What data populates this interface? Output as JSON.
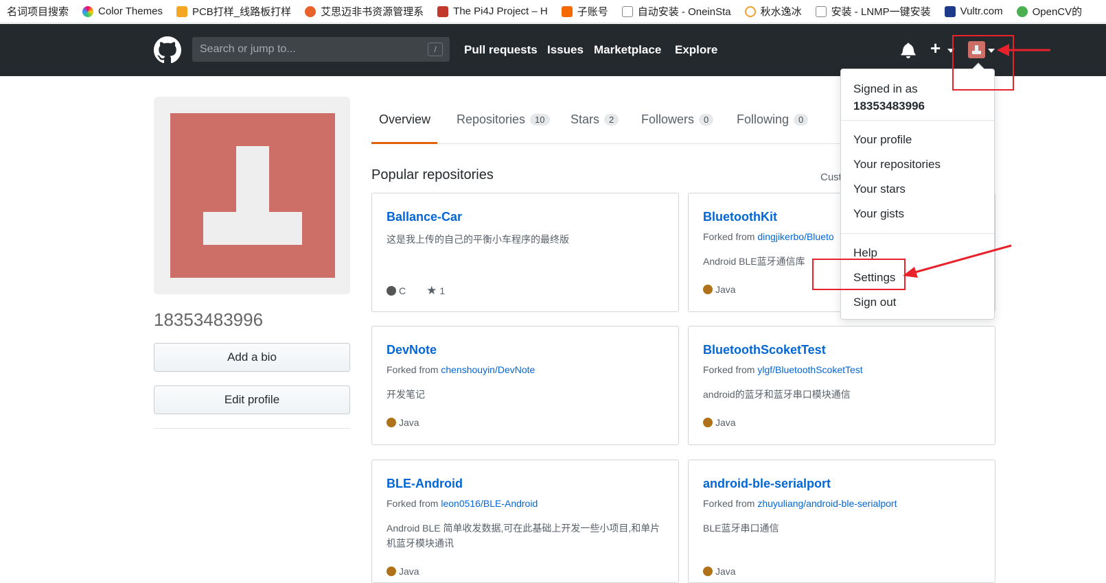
{
  "bookmarks": [
    {
      "label": "名词项目搜索",
      "color": ""
    },
    {
      "label": "Color Themes",
      "color": "#7ab6f0"
    },
    {
      "label": "PCB打样_线路板打样",
      "color": "#f5a623"
    },
    {
      "label": "艾思迈非书资源管理系",
      "color": "#e8612a"
    },
    {
      "label": "The Pi4J Project – H",
      "color": "#c0392b"
    },
    {
      "label": "子账号",
      "color": "#f56a00"
    },
    {
      "label": "自动安装 - OneinSta",
      "color": "#888888"
    },
    {
      "label": "秋水逸冰",
      "color": "#f0a030"
    },
    {
      "label": "安装 - LNMP一键安装",
      "color": "#888888"
    },
    {
      "label": "Vultr.com",
      "color": "#1e3a8a"
    },
    {
      "label": "OpenCV的",
      "color": "#4caf50"
    }
  ],
  "header": {
    "search_placeholder": "Search or jump to...",
    "search_shortcut": "/",
    "nav": [
      "Pull requests",
      "Issues",
      "Marketplace",
      "Explore"
    ]
  },
  "profile": {
    "username": "18353483996",
    "add_bio": "Add a bio",
    "edit_profile": "Edit profile"
  },
  "tabs": [
    {
      "label": "Overview",
      "count": ""
    },
    {
      "label": "Repositories",
      "count": "10"
    },
    {
      "label": "Stars",
      "count": "2"
    },
    {
      "label": "Followers",
      "count": "0"
    },
    {
      "label": "Following",
      "count": "0"
    }
  ],
  "popular_title": "Popular repositories",
  "customize_label": "Cust",
  "repos": [
    {
      "name": "Ballance-Car",
      "forked_prefix": "",
      "forked_from": "",
      "description": "这是我上传的自己的平衡小车程序的最终版",
      "language": "C",
      "lang_color": "#555555",
      "stars": "1"
    },
    {
      "name": "BluetoothKit",
      "forked_prefix": "Forked from",
      "forked_from": "dingjikerbo/Blueto",
      "description": "Android BLE蓝牙通信库",
      "language": "Java",
      "lang_color": "#b07219",
      "stars": ""
    },
    {
      "name": "DevNote",
      "forked_prefix": "Forked from",
      "forked_from": "chenshouyin/DevNote",
      "description": "开发笔记",
      "language": "Java",
      "lang_color": "#b07219",
      "stars": ""
    },
    {
      "name": "BluetoothScoketTest",
      "forked_prefix": "Forked from",
      "forked_from": "ylgf/BluetoothScoketTest",
      "description": "android的蓝牙和蓝牙串口模块通信",
      "language": "Java",
      "lang_color": "#b07219",
      "stars": ""
    },
    {
      "name": "BLE-Android",
      "forked_prefix": "Forked from",
      "forked_from": "leon0516/BLE-Android",
      "description": "Android BLE 简单收发数据,可在此基础上开发一些小项目,和单片机蓝牙模块通讯",
      "language": "Java",
      "lang_color": "#b07219",
      "stars": ""
    },
    {
      "name": "android-ble-serialport",
      "forked_prefix": "Forked from",
      "forked_from": "zhuyuliang/android-ble-serialport",
      "description": "BLE蓝牙串口通信",
      "language": "Java",
      "lang_color": "#b07219",
      "stars": ""
    }
  ],
  "dropdown": {
    "signed_in_as": "Signed in as",
    "signed_user": "18353483996",
    "items1": [
      "Your profile",
      "Your repositories",
      "Your stars",
      "Your gists"
    ],
    "items2": [
      "Help",
      "Settings",
      "Sign out"
    ]
  },
  "colors": {
    "header_bg": "#24292e",
    "accent": "#e36209",
    "link": "#0366d6",
    "annotation": "#e8212a",
    "avatar": "#cd6f66"
  }
}
